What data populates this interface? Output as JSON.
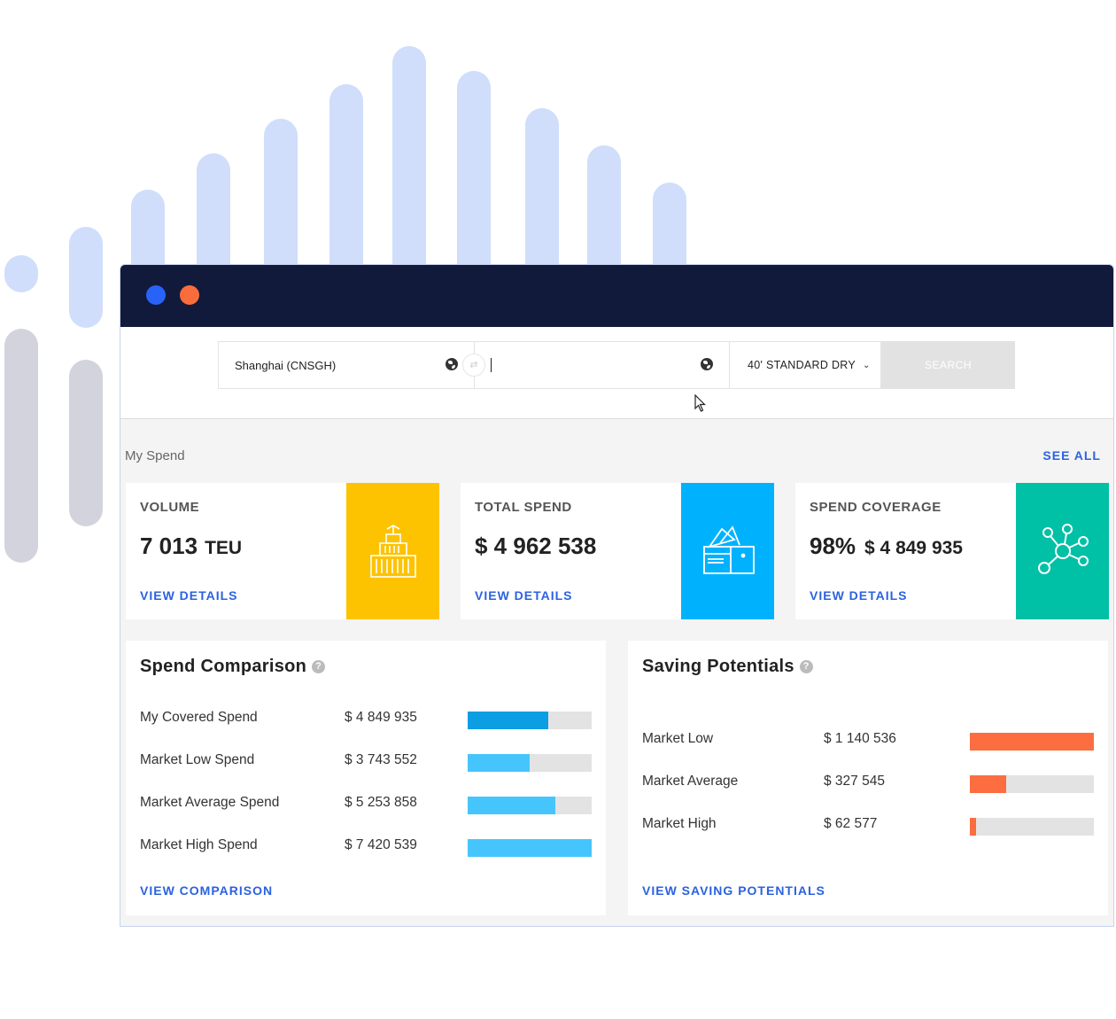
{
  "colors": {
    "titlebar": "#111a3a",
    "dot_blue": "#2962f6",
    "dot_orange": "#f96d3c",
    "link_blue": "#2b62df",
    "volume_tile": "#fdc300",
    "spend_tile": "#00b2fe",
    "coverage_tile": "#00c0a5",
    "comparison_dark": "#0c9ee3",
    "comparison_light": "#45c5fc",
    "saving_orange": "#fc6e3f"
  },
  "search": {
    "origin": "Shanghai (CNSGH)",
    "destination": "",
    "container_type": "40' STANDARD DRY",
    "button": "SEARCH"
  },
  "my_spend": {
    "title": "My Spend",
    "see_all": "SEE ALL",
    "cards": [
      {
        "label": "VOLUME",
        "value": "7 013",
        "unit": "TEU",
        "link": "VIEW DETAILS",
        "icon": "container-icon"
      },
      {
        "label": "TOTAL SPEND",
        "value": "$ 4 962 538",
        "link": "VIEW DETAILS",
        "icon": "wallet-icon"
      },
      {
        "label": "SPEND COVERAGE",
        "value": "98%",
        "sub_value": "$ 4 849 935",
        "link": "VIEW DETAILS",
        "icon": "network-icon"
      }
    ]
  },
  "spend_comparison": {
    "title": "Spend Comparison",
    "help": "?",
    "rows": [
      {
        "label": "My Covered Spend",
        "value": "$ 4 849 935",
        "level": 0.65
      },
      {
        "label": "Market Low Spend",
        "value": "$ 3 743 552",
        "level": 0.5
      },
      {
        "label": "Market Average Spend",
        "value": "$ 5 253 858",
        "level": 0.71
      },
      {
        "label": "Market High Spend",
        "value": "$ 7 420 539",
        "level": 1.0
      }
    ],
    "link": "VIEW COMPARISON"
  },
  "saving_potentials": {
    "title": "Saving Potentials",
    "help": "?",
    "rows": [
      {
        "label": "Market Low",
        "value": "$ 1 140 536",
        "level": 1.0
      },
      {
        "label": "Market Average",
        "value": "$ 327 545",
        "level": 0.29
      },
      {
        "label": "Market High",
        "value": "$ 62 577",
        "level": 0.05
      }
    ],
    "link": "VIEW SAVING POTENTIALS"
  }
}
